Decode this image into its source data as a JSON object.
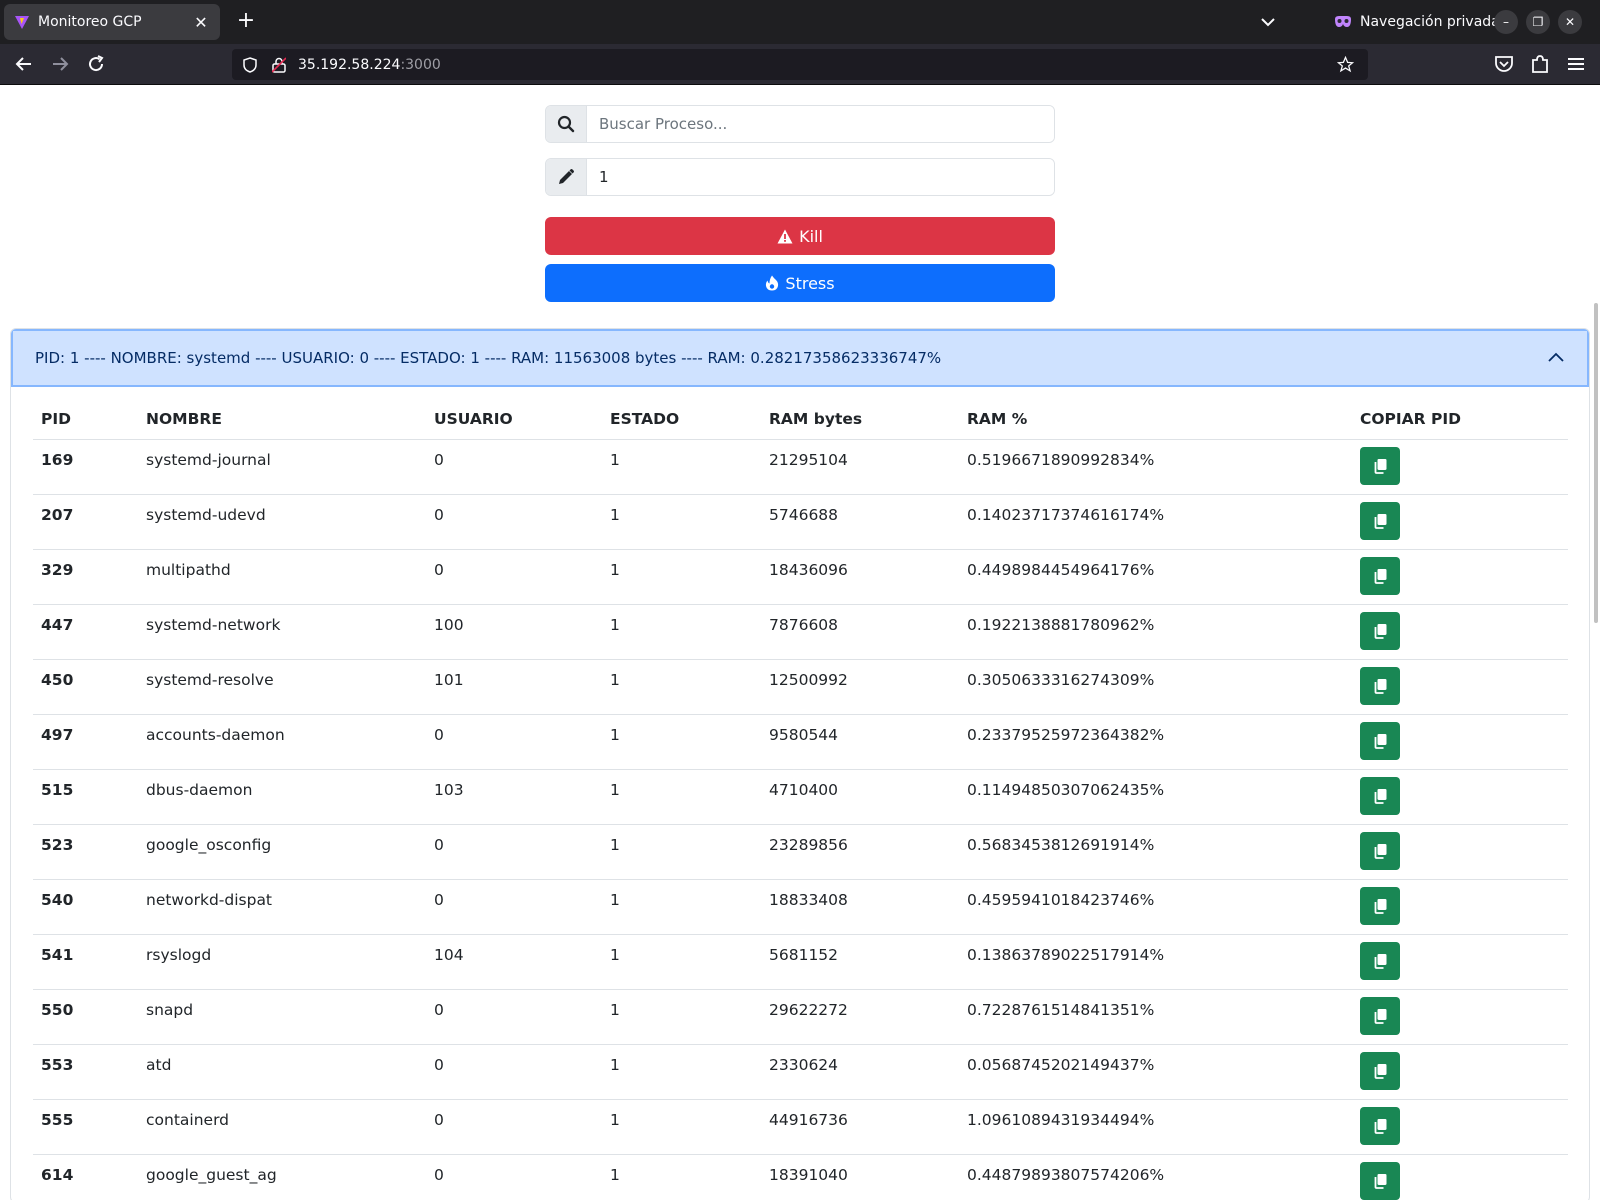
{
  "browser": {
    "tab_title": "Monitoreo GCP",
    "private_label": "Navegación privada",
    "url_host": "35.192.58.224",
    "url_port": ":3000"
  },
  "controls": {
    "search_placeholder": "Buscar Proceso...",
    "pid_value": "1",
    "kill_label": "Kill",
    "stress_label": "Stress"
  },
  "accordion": {
    "header_text": "PID: 1 ---- NOMBRE: systemd ---- USUARIO: 0 ---- ESTADO: 1 ---- RAM: 11563008 bytes ---- RAM: 0.28217358623336747%",
    "expanded": true
  },
  "table": {
    "headers": [
      "PID",
      "NOMBRE",
      "USUARIO",
      "ESTADO",
      "RAM bytes",
      "RAM %",
      "COPIAR PID"
    ],
    "rows": [
      {
        "pid": "169",
        "name": "systemd-journal",
        "user": "0",
        "state": "1",
        "ram_bytes": "21295104",
        "ram_pct": "0.5196671890992834%"
      },
      {
        "pid": "207",
        "name": "systemd-udevd",
        "user": "0",
        "state": "1",
        "ram_bytes": "5746688",
        "ram_pct": "0.14023717374616174%"
      },
      {
        "pid": "329",
        "name": "multipathd",
        "user": "0",
        "state": "1",
        "ram_bytes": "18436096",
        "ram_pct": "0.4498984454964176%"
      },
      {
        "pid": "447",
        "name": "systemd-network",
        "user": "100",
        "state": "1",
        "ram_bytes": "7876608",
        "ram_pct": "0.1922138881780962%"
      },
      {
        "pid": "450",
        "name": "systemd-resolve",
        "user": "101",
        "state": "1",
        "ram_bytes": "12500992",
        "ram_pct": "0.3050633316274309%"
      },
      {
        "pid": "497",
        "name": "accounts-daemon",
        "user": "0",
        "state": "1",
        "ram_bytes": "9580544",
        "ram_pct": "0.23379525972364382%"
      },
      {
        "pid": "515",
        "name": "dbus-daemon",
        "user": "103",
        "state": "1",
        "ram_bytes": "4710400",
        "ram_pct": "0.11494850307062435%"
      },
      {
        "pid": "523",
        "name": "google_osconfig",
        "user": "0",
        "state": "1",
        "ram_bytes": "23289856",
        "ram_pct": "0.5683453812691914%"
      },
      {
        "pid": "540",
        "name": "networkd-dispat",
        "user": "0",
        "state": "1",
        "ram_bytes": "18833408",
        "ram_pct": "0.4595941018423746%"
      },
      {
        "pid": "541",
        "name": "rsyslogd",
        "user": "104",
        "state": "1",
        "ram_bytes": "5681152",
        "ram_pct": "0.13863789022517914%"
      },
      {
        "pid": "550",
        "name": "snapd",
        "user": "0",
        "state": "1",
        "ram_bytes": "29622272",
        "ram_pct": "0.7228761514841351%"
      },
      {
        "pid": "553",
        "name": "atd",
        "user": "0",
        "state": "1",
        "ram_bytes": "2330624",
        "ram_pct": "0.0568745202149437%"
      },
      {
        "pid": "555",
        "name": "containerd",
        "user": "0",
        "state": "1",
        "ram_bytes": "44916736",
        "ram_pct": "1.0961089431934494%"
      },
      {
        "pid": "614",
        "name": "google_guest_ag",
        "user": "0",
        "state": "1",
        "ram_bytes": "18391040",
        "ram_pct": "0.44879893807574206%"
      }
    ]
  },
  "colors": {
    "kill": "#dc3545",
    "stress": "#0d6efd",
    "copy": "#198754",
    "accordion_header_bg": "#cfe2ff"
  },
  "icons": {
    "search_addon": "search-icon",
    "pid_addon": "pencil-icon",
    "kill": "warning-triangle-icon",
    "stress": "fire-icon",
    "copy": "copy-icon"
  }
}
